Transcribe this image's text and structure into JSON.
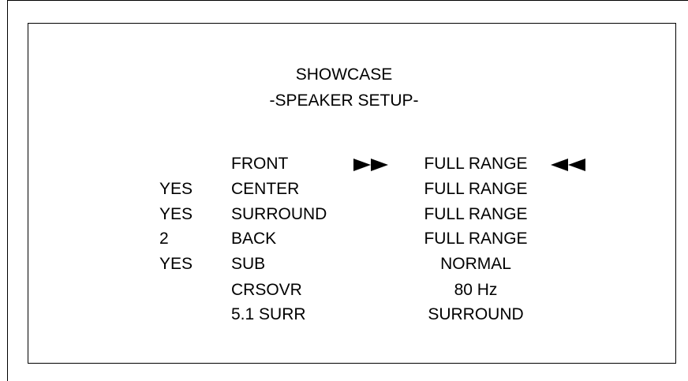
{
  "screen": {
    "title": "SHOWCASE",
    "subtitle": "-SPEAKER SETUP-"
  },
  "menu": {
    "selected_index": 0,
    "rows": [
      {
        "status": "",
        "label": "FRONT",
        "value": "FULL RANGE"
      },
      {
        "status": "YES",
        "label": "CENTER",
        "value": "FULL RANGE"
      },
      {
        "status": "YES",
        "label": "SURROUND",
        "value": "FULL RANGE"
      },
      {
        "status": "2",
        "label": "BACK",
        "value": "FULL RANGE"
      },
      {
        "status": "YES",
        "label": "SUB",
        "value": "NORMAL"
      },
      {
        "status": "",
        "label": "CRSOVR",
        "value": "80 Hz"
      },
      {
        "status": "",
        "label": "5.1 SURR",
        "value": "SURROUND"
      }
    ]
  },
  "icons": {
    "selection_left": "double-right-triangle-icon",
    "selection_right": "double-left-triangle-icon"
  },
  "colors": {
    "foreground": "#000000",
    "background": "#ffffff"
  }
}
